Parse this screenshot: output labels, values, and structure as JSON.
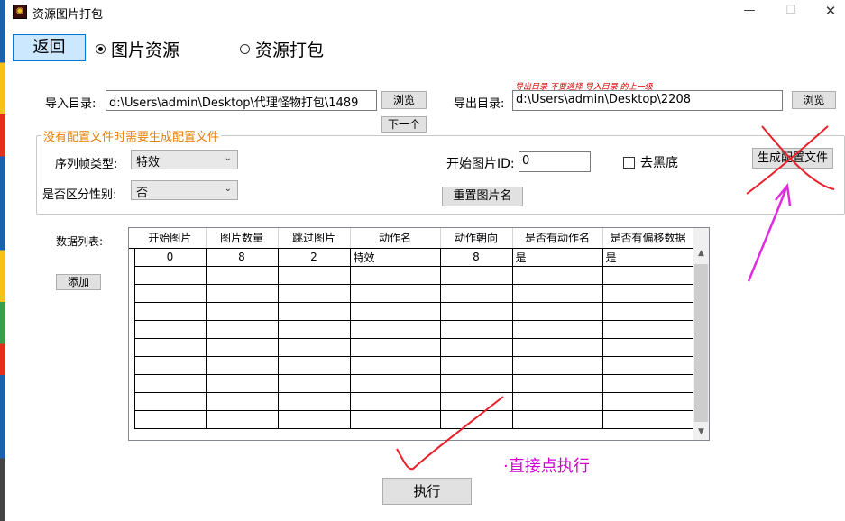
{
  "window": {
    "title": "资源图片打包",
    "min_symbol": "—",
    "max_symbol": "☐",
    "close_symbol": "✕"
  },
  "nav": {
    "back_label": "返回",
    "radio_image_resource": "图片资源",
    "radio_resource_pack": "资源打包",
    "selected": "图片资源"
  },
  "import": {
    "label": "导入目录:",
    "path": "d:\\Users\\admin\\Desktop\\代理怪物打包\\1489",
    "browse_label": "浏览",
    "next_label": "下一个"
  },
  "export": {
    "label": "导出目录:",
    "path": "d:\\Users\\admin\\Desktop\\2208",
    "browse_label": "浏览",
    "hint": "导出目录 不要选择 导入目录 的上一级"
  },
  "config_group": {
    "title": "没有配置文件时需要生成配置文件",
    "sequence_type_label": "序列帧类型:",
    "sequence_type_value": "特效",
    "gender_label": "是否区分性别:",
    "gender_value": "否",
    "start_id_label": "开始图片ID:",
    "start_id_value": "0",
    "black_bg_label": "去黑底",
    "black_bg_checked": false,
    "rename_label": "重置图片名",
    "generate_label": "生成配置文件"
  },
  "data_list": {
    "label": "数据列表:",
    "add_label": "添加",
    "columns": [
      "开始图片",
      "图片数量",
      "跳过图片",
      "动作名",
      "动作朝向",
      "是否有动作名",
      "是否有偏移数据"
    ],
    "rows": [
      [
        "0",
        "8",
        "2",
        "特效",
        "8",
        "是",
        "是"
      ]
    ]
  },
  "execute_label": "执行",
  "annotation": {
    "text": "·直接点执行",
    "color": "#d100d1",
    "mark_color": "#e8202a"
  }
}
